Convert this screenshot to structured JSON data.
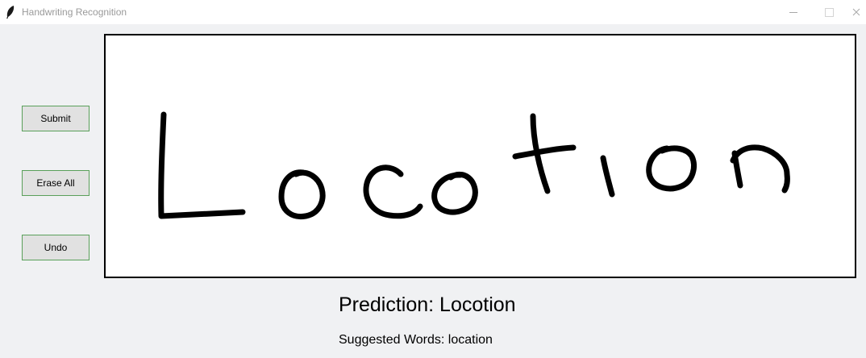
{
  "window": {
    "title": "Handwriting Recognition",
    "icon": "feather-icon",
    "controls": {
      "minimize": "minimize-icon",
      "maximize": "maximize-icon",
      "close": "close-icon"
    }
  },
  "buttons": {
    "submit": "Submit",
    "erase_all": "Erase All",
    "undo": "Undo"
  },
  "canvas": {
    "stroke_color": "#000000",
    "background": "#ffffff",
    "handwritten_word": "Locotion"
  },
  "result": {
    "prediction": "Prediction: Locotion",
    "suggested": "Suggested Words: location"
  },
  "colors": {
    "button_border": "#5aa05a",
    "button_bg": "#e1e1e1",
    "window_bg": "#f0f1f3"
  }
}
